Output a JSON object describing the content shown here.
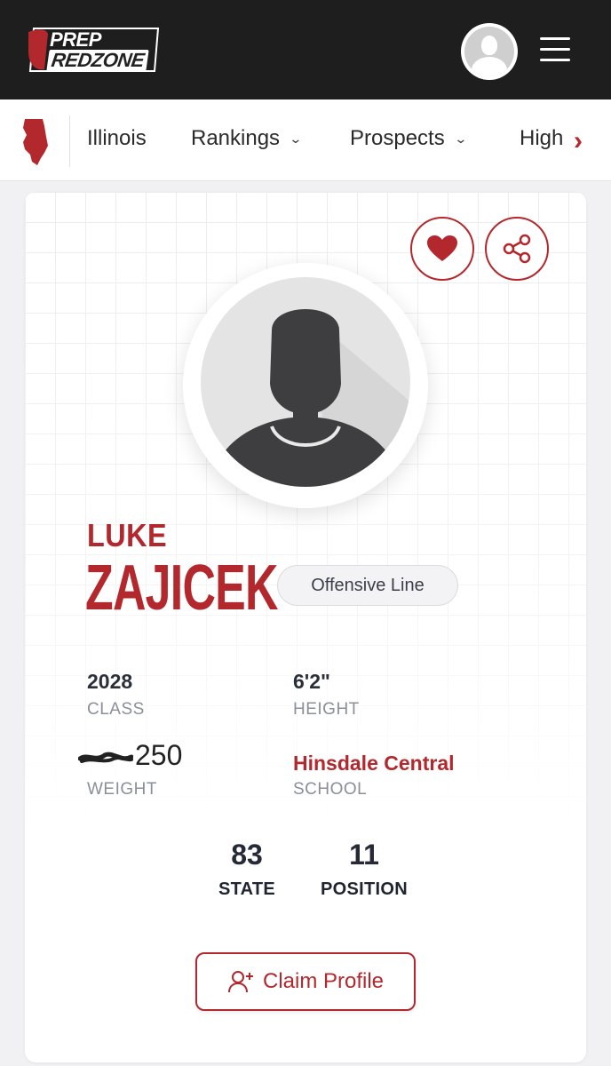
{
  "brand": {
    "line1": "PREP",
    "line2": "REDZONE"
  },
  "nav": {
    "state": "Illinois",
    "items": [
      {
        "label": "Rankings"
      },
      {
        "label": "Prospects"
      },
      {
        "label": "Highlights"
      }
    ]
  },
  "player": {
    "first_name": "LUKE",
    "last_name": "ZAJICEK",
    "position": "Offensive Line",
    "class_value": "2028",
    "class_label": "CLASS",
    "height_value": "6'2\"",
    "height_label": "HEIGHT",
    "weight_value": "250",
    "weight_label": "WEIGHT",
    "school_value": "Hinsdale Central",
    "school_label": "SCHOOL"
  },
  "rankings": {
    "state_value": "83",
    "state_label": "STATE",
    "position_value": "11",
    "position_label": "POSITION"
  },
  "actions": {
    "claim_label": "Claim Profile"
  },
  "colors": {
    "accent": "#b3282d",
    "topbar": "#1e1e1e"
  }
}
